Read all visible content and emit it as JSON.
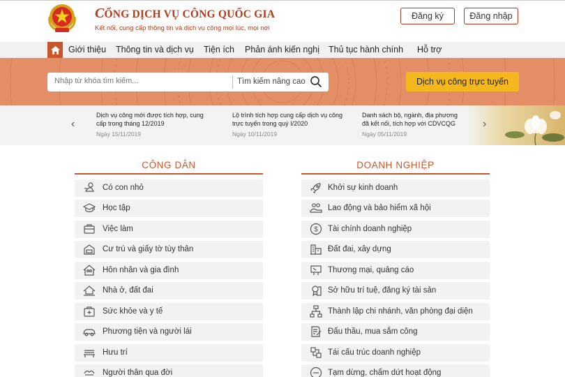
{
  "header": {
    "title_first": "C",
    "title_rest": "ỔNG DỊCH VỤ CÔNG QUỐC GIA",
    "subtitle": "Kết nối, cung cấp thông tin và dịch vụ công mọi lúc, mọi nơi",
    "register_label": "Đăng ký",
    "login_label": "Đăng nhập"
  },
  "nav": {
    "items": [
      "Giới thiệu",
      "Thông tin và dịch vụ",
      "Tiện ích",
      "Phản ánh kiến nghị",
      "Thủ tục hành chính",
      "Hỗ trợ"
    ]
  },
  "search": {
    "placeholder": "Nhập từ khóa tìm kiếm...",
    "advanced_label": "Tìm kiếm nâng cao",
    "online_service_label": "Dịch vụ công trực tuyến"
  },
  "news": [
    {
      "title": "Dịch vụ công mới được tích hợp, cung cấp trong tháng 12/2019",
      "date": "Ngày 15/11/2019"
    },
    {
      "title": "Lộ trình tích hợp cung cấp dịch vụ công trực tuyến trong quý I/2020",
      "date": "Ngày 10/11/2019"
    },
    {
      "title": "Danh sách bộ, ngành, địa phương đã kết nối, tích hợp với CDVCQG",
      "date": "Ngày 05/11/2019"
    }
  ],
  "citizen": {
    "heading": "CÔNG DÂN",
    "items": [
      {
        "label": "Có con nhỏ",
        "icon": "baby-icon"
      },
      {
        "label": "Học tập",
        "icon": "graduation-cap-icon"
      },
      {
        "label": "Việc làm",
        "icon": "briefcase-icon"
      },
      {
        "label": "Cư trú và giấy tờ tùy thân",
        "icon": "id-card-icon"
      },
      {
        "label": "Hôn nhân và gia đình",
        "icon": "family-home-icon"
      },
      {
        "label": "Nhà ở, đất đai",
        "icon": "house-land-icon"
      },
      {
        "label": "Sức khỏe và y tế",
        "icon": "medical-kit-icon"
      },
      {
        "label": "Phương tiện và người lái",
        "icon": "car-icon"
      },
      {
        "label": "Hưu trí",
        "icon": "bench-icon"
      },
      {
        "label": "Người thân qua đời",
        "icon": "hands-icon"
      }
    ]
  },
  "business": {
    "heading": "DOANH NGHIỆP",
    "items": [
      {
        "label": "Khởi sự kinh doanh",
        "icon": "rocket-icon"
      },
      {
        "label": "Lao động và bảo hiểm xã hội",
        "icon": "workers-icon"
      },
      {
        "label": "Tài chính doanh nghiệp",
        "icon": "dollar-icon"
      },
      {
        "label": "Đất đai, xây dựng",
        "icon": "building-icon"
      },
      {
        "label": "Thương mại, quảng cáo",
        "icon": "billboard-icon"
      },
      {
        "label": "Sở hữu trí tuệ, đăng ký tài sản",
        "icon": "certificate-icon"
      },
      {
        "label": "Thành lập chi nhánh, văn phòng đại diện",
        "icon": "org-chart-icon"
      },
      {
        "label": "Đấu thầu, mua sắm công",
        "icon": "contract-icon"
      },
      {
        "label": "Tái cấu trúc doanh nghiệp",
        "icon": "restructure-icon"
      },
      {
        "label": "Tạm dừng, chấm dứt hoạt động",
        "icon": "stop-icon"
      }
    ]
  },
  "colors": {
    "brand_red": "#b23a1a",
    "accent_orange": "#c8562c",
    "banner": "#e38e66",
    "button_yellow": "#f4b71d"
  }
}
